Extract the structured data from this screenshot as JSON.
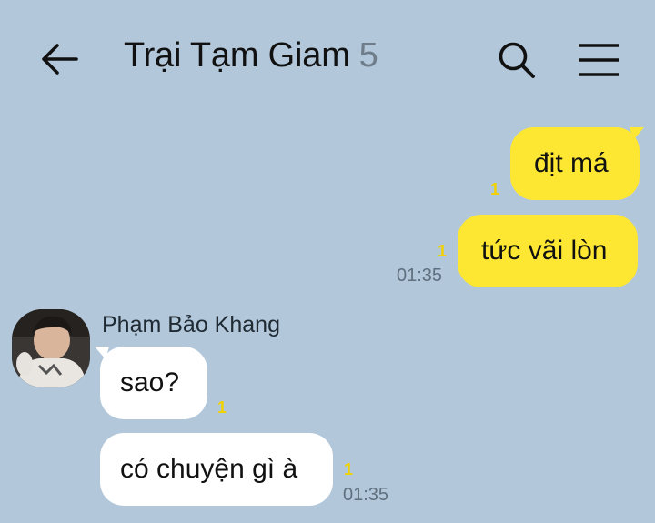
{
  "header": {
    "title": "Trại Tạm Giam",
    "member_count": "5",
    "icons": {
      "back": "arrow-left-icon",
      "search": "search-icon",
      "menu": "hamburger-menu-icon"
    }
  },
  "colors": {
    "background": "#b2c7da",
    "my_bubble": "#fee733",
    "other_bubble": "#ffffff",
    "unread": "#f2d100"
  },
  "messages": [
    {
      "from": "me",
      "text": "địt má",
      "unread": "1",
      "time": ""
    },
    {
      "from": "me",
      "text": "tức vãi lòn",
      "unread": "1",
      "time": "01:35"
    },
    {
      "from": "other",
      "sender": "Phạm Bảo Khang",
      "text": "sao?",
      "unread": "1",
      "time": ""
    },
    {
      "from": "other",
      "text": "có chuyện gì à",
      "unread": "1",
      "time": "01:35"
    }
  ]
}
